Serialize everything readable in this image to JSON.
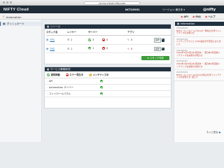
{
  "browser": {
    "url": "cp.mo.cloud.nifty.com"
  },
  "topbar": {
    "logo": "NIFTY Cloud",
    "account": "NCT43951",
    "region": "リージョン:東日本 ▾",
    "user": "@nifty"
  },
  "subbar": {
    "search_label": "Automation",
    "tools": [
      "API",
      "FAQ",
      "ヘルプ"
    ]
  },
  "sidebar": {
    "items": [
      {
        "label": "ダッシュボード",
        "icon": "dashboard-icon"
      }
    ]
  },
  "resources": {
    "title": "リソース",
    "columns": [
      "スタック名",
      "レイヤー",
      "サーバー",
      "",
      "アプリ",
      ""
    ],
    "rows": [
      {
        "name": "TR1",
        "layers": "2",
        "servers_ok": "3",
        "servers_err": "0",
        "apps": "0",
        "op": "操作"
      },
      {
        "name": "TR2",
        "layers": "1",
        "servers_ok": "1",
        "servers_err": "0",
        "apps": "0",
        "op": "操作"
      }
    ],
    "create_button": "スタック作成"
  },
  "services": {
    "title": "サービス稼働状況",
    "legend": [
      "通常稼働",
      "エラー発生中",
      "メンテナンス中"
    ],
    "rows": [
      "API",
      "Automation サーバー",
      "コントロールパネル"
    ]
  },
  "information": {
    "title": "Information",
    "items": [
      {
        "date": "2013/05/29",
        "title": "NIQロ コントロールパネルの一時停止を伴うメンテナンスのお知らせ"
      },
      {
        "date": "2013/05/29",
        "title": "ニフティクラウドにてSSH接続が不安定になりました"
      },
      {
        "date": "2013/05/31",
        "title": "2014年1月29日(水)東日本 ・ 西日本2月定期メンテナンスを実施のお知らせ"
      },
      {
        "date": "2013/05/31",
        "title": "2014年1月29日(水)東日本 ・ 西日本2月定期メンテナンスを実施のお知らせ"
      },
      {
        "date": "2013/05/29",
        "title": "NIQロ コントロールパネルの停止を伴うメンテナンスのお知らせ【完了】"
      }
    ],
    "more": "もっと見る"
  },
  "colors": {
    "navbar": "#1f2c37",
    "ok": "#2f9e2f",
    "error": "#c9302c",
    "maintenance": "#e59f1c",
    "accent": "#2d6ca2"
  }
}
